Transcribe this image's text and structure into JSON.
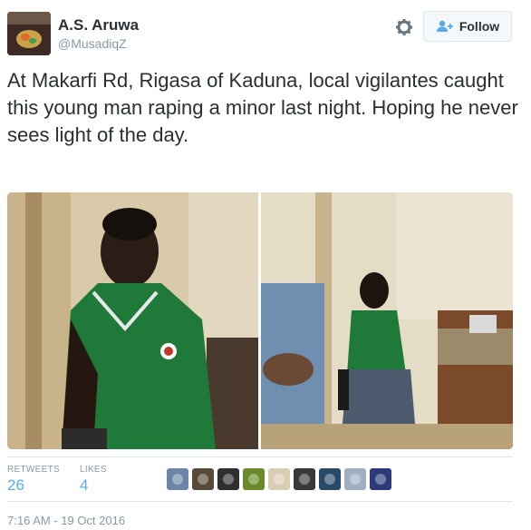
{
  "author": {
    "name": "A.S. Aruwa",
    "handle": "@MusadiqZ"
  },
  "follow_label": "Follow",
  "tweet_text": "At Makarfi Rd, Rigasa of Kaduna, local vigilantes caught this young man raping a minor last night. Hoping he never sees light of the day.",
  "stats": {
    "retweets_label": "RETWEETS",
    "retweets_value": "26",
    "likes_label": "LIKES",
    "likes_value": "4"
  },
  "likers": [
    {
      "icon": "liker-avatar-1",
      "color": "#6b86a8"
    },
    {
      "icon": "liker-avatar-2",
      "color": "#5a4a3a"
    },
    {
      "icon": "liker-avatar-3",
      "color": "#2f2f2f"
    },
    {
      "icon": "liker-avatar-4",
      "color": "#6a8a2a"
    },
    {
      "icon": "liker-avatar-5",
      "color": "#d9cdb0"
    },
    {
      "icon": "liker-avatar-6",
      "color": "#3a3a3a"
    },
    {
      "icon": "liker-avatar-7",
      "color": "#2a4a6a"
    },
    {
      "icon": "liker-avatar-8",
      "color": "#9fb0c0"
    },
    {
      "icon": "liker-avatar-9",
      "color": "#2a3a7a"
    }
  ],
  "timestamp": "7:16 AM - 19 Oct 2016",
  "colors": {
    "link_blue": "#55acee",
    "muted": "#8899a6",
    "text": "#292f33"
  }
}
